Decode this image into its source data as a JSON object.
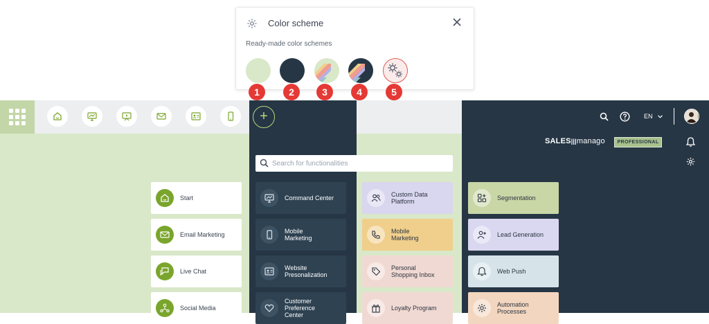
{
  "popup": {
    "title": "Color scheme",
    "subtitle": "Ready-made color schemes",
    "schemes": [
      {
        "number": "1",
        "name": "light-green"
      },
      {
        "number": "2",
        "name": "dark-navy"
      },
      {
        "number": "3",
        "name": "pastel-stripes-light"
      },
      {
        "number": "4",
        "name": "pastel-stripes-dark"
      },
      {
        "number": "5",
        "name": "custom-settings"
      }
    ]
  },
  "topbar": {
    "language": "EN",
    "add_symbol": "+"
  },
  "search": {
    "placeholder": "Search for functionalities"
  },
  "brand": {
    "logo_part1": "SALES",
    "logo_part2": "manago",
    "plan_badge": "PROFESSIONAL"
  },
  "tiles": {
    "col1": [
      {
        "label": "Start",
        "icon": "home-icon"
      },
      {
        "label": "Email Marketing",
        "icon": "mail-icon"
      },
      {
        "label": "Live Chat",
        "icon": "chat-icon"
      },
      {
        "label": "Social Media",
        "icon": "network-icon"
      }
    ],
    "col2": [
      {
        "label": "Command Center",
        "icon": "chart-monitor-icon"
      },
      {
        "label": "Mobile Marketing",
        "icon": "phone-icon"
      },
      {
        "label": "Website Presonalization",
        "icon": "id-card-icon"
      },
      {
        "label": "Customer Preference Center",
        "icon": "heart-icon"
      }
    ],
    "col3": [
      {
        "label": "Custom Data Platform",
        "icon": "users-icon"
      },
      {
        "label": "Mobile Marketing",
        "icon": "phone-call-icon"
      },
      {
        "label": "Personal Shopping Inbox",
        "icon": "tag-icon"
      },
      {
        "label": "Loyalty Program",
        "icon": "gift-icon"
      }
    ],
    "col4": [
      {
        "label": "Segmentation",
        "icon": "grid-plus-icon"
      },
      {
        "label": "Lead Generation",
        "icon": "user-plus-icon"
      },
      {
        "label": "Web Push",
        "icon": "bell-icon"
      },
      {
        "label": "Automation Processes",
        "icon": "gear-icon"
      }
    ]
  },
  "colors": {
    "green_band": "#d9e8c8",
    "navy_band": "#263645",
    "accent_green": "#7aa52c",
    "badge_red": "#e53935",
    "tile_purple": "#d9d6ef",
    "tile_orange": "#f0cf8c",
    "tile_pink": "#f1d9d3",
    "tile_olive": "#c9d6a6",
    "tile_lavender": "#dad8f0",
    "tile_lightblue": "#d6e4e9",
    "tile_peach": "#f3d6bf"
  }
}
